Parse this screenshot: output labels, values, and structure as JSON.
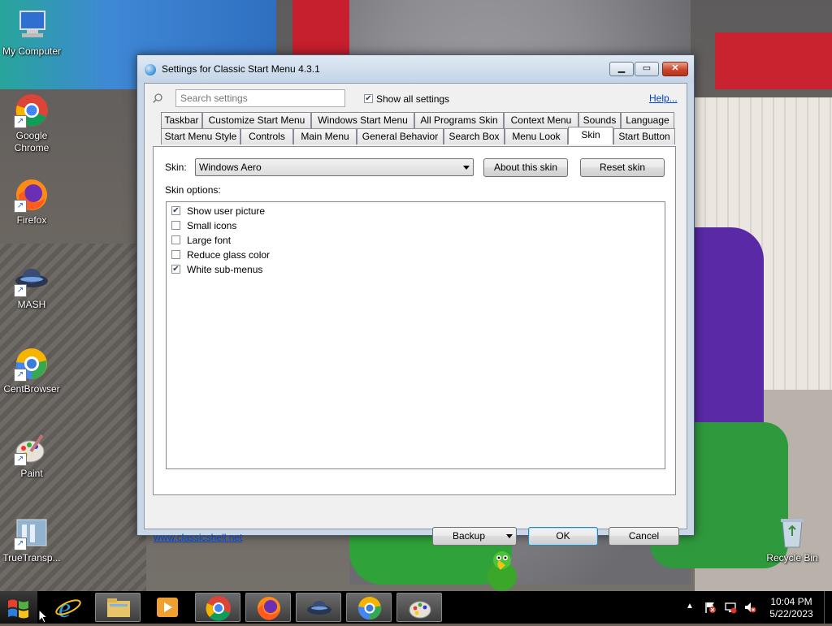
{
  "desktop": {
    "icons": [
      {
        "label": "My Computer"
      },
      {
        "label": "Google Chrome"
      },
      {
        "label": "Firefox"
      },
      {
        "label": "MASH"
      },
      {
        "label": "CentBrowser"
      },
      {
        "label": "Paint"
      },
      {
        "label": "TrueTransp..."
      },
      {
        "label": "Recycle Bin"
      }
    ]
  },
  "window": {
    "title": "Settings for Classic Start Menu 4.3.1",
    "search": {
      "placeholder": "Search settings"
    },
    "show_all": {
      "label": "Show all settings",
      "checked": true
    },
    "help_link": "Help...",
    "tabs_row1": [
      "Taskbar",
      "Customize Start Menu",
      "Windows Start Menu",
      "All Programs Skin",
      "Context Menu",
      "Sounds",
      "Language"
    ],
    "tabs_row2": [
      "Start Menu Style",
      "Controls",
      "Main Menu",
      "General Behavior",
      "Search Box",
      "Menu Look",
      "Skin",
      "Start Button"
    ],
    "active_tab": "Skin",
    "skin": {
      "label": "Skin:",
      "value": "Windows Aero",
      "about_button": "About this skin",
      "reset_button": "Reset skin",
      "options_label": "Skin options:",
      "options": [
        {
          "label": "Show user picture",
          "checked": true
        },
        {
          "label": "Small icons",
          "checked": false
        },
        {
          "label": "Large font",
          "checked": false
        },
        {
          "label": "Reduce glass color",
          "checked": false
        },
        {
          "label": "White sub-menus",
          "checked": true
        }
      ]
    },
    "footer": {
      "site_link": "www.classicshell.net",
      "backup_button": "Backup",
      "ok_button": "OK",
      "cancel_button": "Cancel"
    }
  },
  "taskbar": {
    "pinned": [
      "internet-explorer",
      "file-explorer",
      "media-player",
      "google-chrome",
      "firefox",
      "mash",
      "centbrowser",
      "paint"
    ],
    "clock": {
      "time": "10:04 PM",
      "date": "5/22/2023"
    }
  }
}
